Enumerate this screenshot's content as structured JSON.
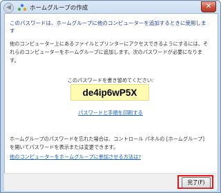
{
  "window": {
    "title": "ホームグループの作成",
    "close_glyph": "✕",
    "back_glyph": "◀"
  },
  "content": {
    "heading": "このパスワードは、ホームグループに他のコンピューターを追加するときに使用します",
    "description": "他のコンピューター上にあるファイルとプリンターにアクセスできるようにするには、それらのコンピューターをホームグループに追加します。次のパスワードが必要になります。",
    "password_prompt": "このパスワードを書き留めてください:",
    "password": "de4ip6wP5X",
    "print_link": "パスワードと手順を印刷する",
    "bottom_text": "ホームグループのパスワードを忘れた場合は、コントロール パネルの [ホームグループ] を開いてパスワードを表示または変更できます。",
    "help_link": "他のコンピューターをホームグループに参加させる方法は?"
  },
  "footer": {
    "finish_label": "完了(F)"
  },
  "colors": {
    "heading": "#1a3d9e",
    "link": "#1a5fb8",
    "password_bg": "#fffbb0",
    "highlight": "#e8141a"
  }
}
